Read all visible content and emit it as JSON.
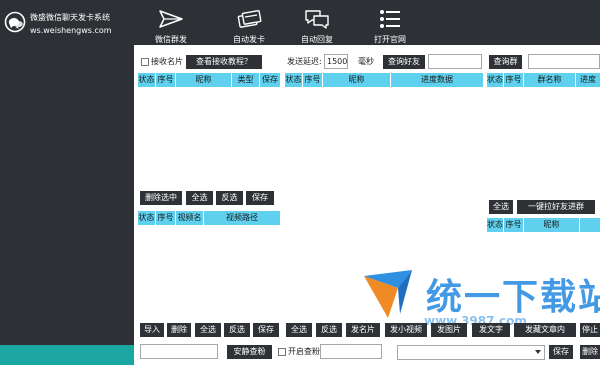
{
  "app": {
    "title": "微盛微信聊天发卡系统",
    "site": "ws.weishengws.com"
  },
  "nav": [
    {
      "label": "微信群发",
      "icon": "paper-plane-icon"
    },
    {
      "label": "自动发卡",
      "icon": "cards-icon"
    },
    {
      "label": "自动回复",
      "icon": "chat-bubbles-icon"
    },
    {
      "label": "打开官网",
      "icon": "list-icon"
    }
  ],
  "left_panel": {
    "receive_card_label": "接收名片",
    "view_tutorial_button": "查看接收教程？",
    "friends_table_headers": [
      "状态",
      "序号",
      "昵称",
      "类型",
      "保存"
    ],
    "delete_selected": "删除选中",
    "select_all": "全选",
    "invert": "反选",
    "save": "保存",
    "video_table_headers": [
      "状态",
      "序号",
      "视频名",
      "视频路径"
    ],
    "import": "导入",
    "delete": "删除",
    "select_all_2": "全选",
    "invert_2": "反选",
    "save_2": "保存",
    "quiet_check": "安静查粉"
  },
  "middle_panel": {
    "send_delay_label": "发送延迟:",
    "send_delay_value": "1500",
    "ms_label": "毫秒",
    "query_friends": "查询好友",
    "table_headers": [
      "状态",
      "序号",
      "昵称",
      "进度数据"
    ],
    "select_all": "全选",
    "invert": "反选",
    "send_card": "发名片",
    "send_video": "发小视频",
    "send_image": "发图片",
    "send_text": "发文字",
    "send_favorite": "发藏文章内",
    "stop": "停止",
    "enable_check_label": "开启查粉"
  },
  "right_panel": {
    "query_group": "查询群",
    "group_table_headers": [
      "状态",
      "序号",
      "群名称",
      "进度"
    ],
    "select_all": "全选",
    "pull_friends": "一键拉好友进群",
    "member_table_headers": [
      "状态",
      "序号",
      "昵称"
    ],
    "save": "保存",
    "delete": "删除"
  },
  "watermark": {
    "text": "统一下载站",
    "sub": "www.3987.com"
  },
  "colors": {
    "chrome": "#2d3136",
    "table_header": "#5fd1ef",
    "teal": "#1ba6a2"
  }
}
